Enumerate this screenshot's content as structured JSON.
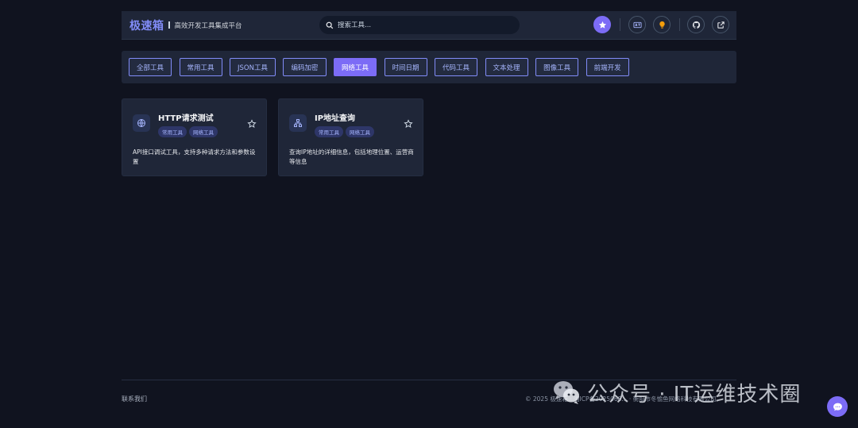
{
  "header": {
    "logo": "极速箱",
    "tagline": "高效开发工具集成平台",
    "search_placeholder": "搜索工具...",
    "icons": [
      "star-icon",
      "translate-icon",
      "lightbulb-icon",
      "github-icon",
      "external-link-icon"
    ]
  },
  "categories": [
    {
      "label": "全部工具",
      "active": false
    },
    {
      "label": "常用工具",
      "active": false
    },
    {
      "label": "JSON工具",
      "active": false
    },
    {
      "label": "编码加密",
      "active": false
    },
    {
      "label": "网络工具",
      "active": true
    },
    {
      "label": "时间日期",
      "active": false
    },
    {
      "label": "代码工具",
      "active": false
    },
    {
      "label": "文本处理",
      "active": false
    },
    {
      "label": "图像工具",
      "active": false
    },
    {
      "label": "前端开发",
      "active": false
    }
  ],
  "tools": [
    {
      "title": "HTTP请求测试",
      "icon": "globe-icon",
      "tags": [
        "常用工具",
        "网络工具"
      ],
      "description": "API接口调试工具，支持多种请求方法和参数设置"
    },
    {
      "title": "IP地址查询",
      "icon": "network-icon",
      "tags": [
        "常用工具",
        "网络工具"
      ],
      "description": "查询IP地址的详细信息，包括地理位置、运营商等信息"
    }
  ],
  "footer": {
    "contact": "联系我们",
    "copyright": "© 2025 极速箱 · 湘ICP备2025068... · 衡阳市冬愉鱼网络科技有限公司"
  },
  "watermark": {
    "text": "公众号 · IT运维技术圈"
  },
  "colors": {
    "background": "#10131f",
    "panel": "#1f2638",
    "accent": "#7c6cf6",
    "accent_light": "#818cf8"
  }
}
